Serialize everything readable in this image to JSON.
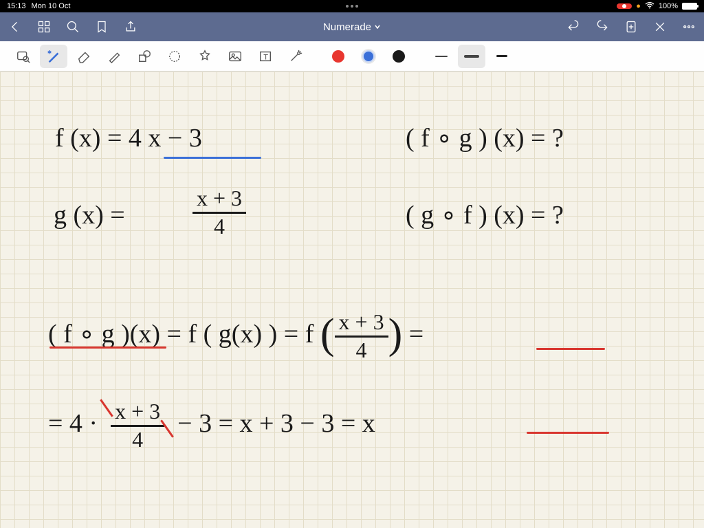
{
  "status_bar": {
    "time": "15:13",
    "date": "Mon 10 Oct",
    "battery_pct": "100%"
  },
  "nav": {
    "title": "Numerade"
  },
  "toolbar": {
    "colors": {
      "red": "#e8362f",
      "blue": "#3a6fd8",
      "black": "#1a1a1a"
    }
  },
  "handwriting": {
    "line1_f": "f (x)  =  4 x − 3",
    "line1_q": "( f ∘ g ) (x)  =  ?",
    "line2_g_lhs": "g (x)   =",
    "line2_g_num": "x + 3",
    "line2_g_den": "4",
    "line2_q": "( g ∘ f ) (x)  =  ?",
    "line3_a": "( f ∘ g )(x)  =  f ( g(x) )   =  f",
    "line3_frac_num": "x + 3",
    "line3_frac_den": "4",
    "line3_tail": "=",
    "line4_a": "=  4 ·",
    "line4_frac_num": "x + 3",
    "line4_frac_den": "4",
    "line4_b": "− 3  =  x + 3 − 3  =   x"
  }
}
